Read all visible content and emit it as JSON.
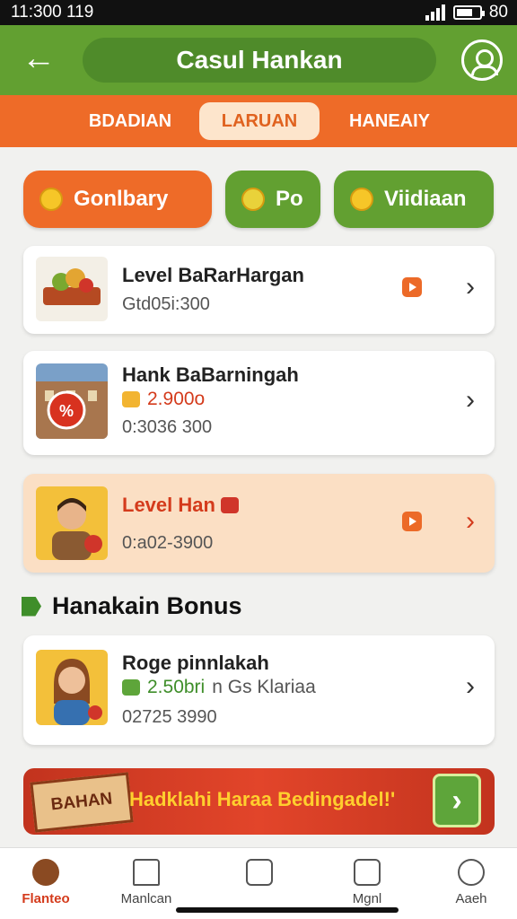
{
  "status_bar": {
    "time": "11:300 119",
    "right_text": "80"
  },
  "header": {
    "title": "Casul Hankan"
  },
  "tabs": [
    {
      "label": "BDADIAN"
    },
    {
      "label": "LARUAN"
    },
    {
      "label": "HANEAIY"
    }
  ],
  "filter_chips": [
    {
      "label": "Gonlbary"
    },
    {
      "label": "Po"
    },
    {
      "label": "Viidiaan"
    }
  ],
  "cards": [
    {
      "title": "Level BaRarHargan",
      "subtitle": "Gtd05i:300"
    },
    {
      "title": "Hank BaBarningah",
      "price": "2.900o",
      "subtitle": "0:3036 300"
    },
    {
      "title": "Level Han",
      "subtitle": "0:a02-3900"
    }
  ],
  "section": {
    "title": "Hanakain Bonus"
  },
  "bonus_card": {
    "title": "Roge pinnlakah",
    "price": "2.50bri",
    "price_note": "n Gs Klariaa",
    "subtitle": "02725 3990"
  },
  "banner": {
    "stamp": "BAHAN",
    "text": "Hadklahi Haraa Bedingadel!'"
  },
  "bottom_nav": [
    {
      "label": "Flanteo",
      "icon": "avatar-icon"
    },
    {
      "label": "Manlcan",
      "icon": "home-icon"
    },
    {
      "label": "",
      "icon": "list-icon"
    },
    {
      "label": "Mgnl",
      "icon": "book-icon"
    },
    {
      "label": "Aaeh",
      "icon": "user-icon"
    }
  ],
  "colors": {
    "green": "#62a031",
    "orange": "#ee6b28",
    "red": "#d43b1c"
  }
}
